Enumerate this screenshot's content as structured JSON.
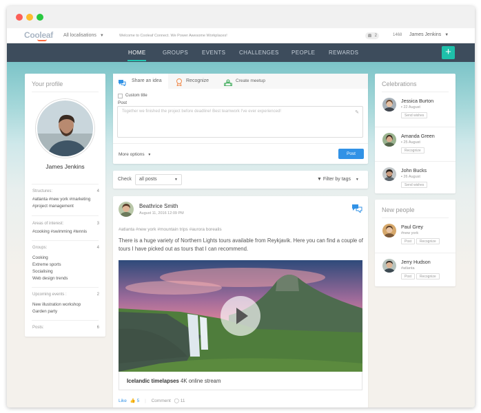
{
  "topbar": {
    "logo": "Cooleaf",
    "location": "All localisations",
    "welcome": "Welcome to Cooleaf Connect. We Power Awesome Workplaces!",
    "notifications": "2",
    "points": "1468",
    "user_name": "James Jenkins"
  },
  "nav": {
    "items": [
      "HOME",
      "GROUPS",
      "EVENTS",
      "CHALLENGES",
      "PEOPLE",
      "REWARDS"
    ],
    "plus": "+"
  },
  "profile": {
    "title": "Your profile",
    "name": "James Jenkins",
    "structures_label": "Structures:",
    "structures_count": "4",
    "structures_tags": "#atlanta  #new york  #marketing\n#project management",
    "interests_label": "Areas of interest:",
    "interests_count": "3",
    "interests_tags": "#cooking  #swimming  #tennis",
    "groups_label": "Groups:",
    "groups_count": "4",
    "groups": [
      "Cooking",
      "Extreme sports",
      "Socialising",
      "Web design trends"
    ],
    "events_label": "Upcoming events :",
    "events_count": "2",
    "events": [
      "New illustration workshop",
      "Garden party"
    ],
    "posts_label": "Posts:",
    "posts_count": "6"
  },
  "composer": {
    "tabs": [
      "Share an idea",
      "Recognize",
      "Create meetup"
    ],
    "custom_title": "Custom title",
    "post_label": "Post",
    "placeholder": "Together we finished the project before deadline! Best teamwork I've ever experienced!",
    "more_options": "More options",
    "post_button": "Post"
  },
  "filter": {
    "check_label": "Check",
    "selected": "all posts",
    "filter_by": "Filter by tags"
  },
  "post": {
    "author": "Beathrice Smith",
    "date": "August 11, 2016  12:09 PM",
    "tags": "#atlanta  #new york  #mountain trips  #aurora borealis",
    "text": "There is a huge variety of Northern Lights tours available from Reykjavik. Here you can find a couple of tours I have picked out as tours that I can recommend.",
    "caption_bold": "Icelandic timelapses",
    "caption_rest": " 4K online stream",
    "like_label": "Like",
    "like_count": "5",
    "comment_label": "Comment",
    "comment_count": "11"
  },
  "celebrations": {
    "title": "Celebrations",
    "people": [
      {
        "name": "Jessica Burton",
        "date": "22 August",
        "button": "Send wishes"
      },
      {
        "name": "Amanda Green",
        "date": "25 August",
        "button": "Recognize"
      },
      {
        "name": "John Bucks",
        "date": "26 August",
        "button": "Send wishes"
      }
    ]
  },
  "new_people": {
    "title": "New people",
    "people": [
      {
        "name": "Paul Grey",
        "tag": "#new york",
        "post": "Post",
        "recognize": "Recognize"
      },
      {
        "name": "Jerry Hudson",
        "tag": "#atlanta",
        "post": "Post",
        "recognize": "Recognize"
      }
    ]
  },
  "colors": {
    "nav_bg": "#3d4c5c",
    "accent": "#1ec0aa",
    "primary_button": "#3192e6"
  }
}
